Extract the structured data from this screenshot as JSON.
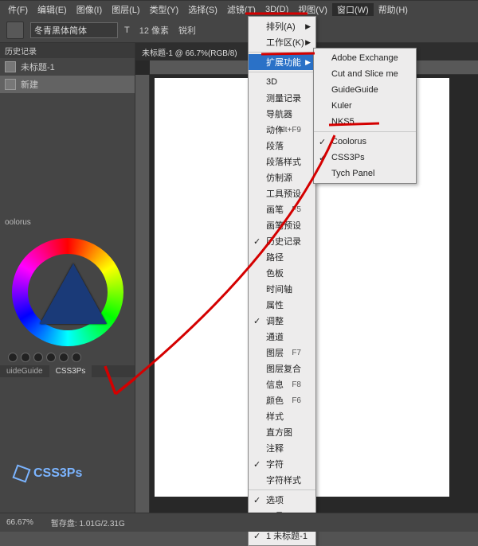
{
  "menubar": {
    "items": [
      "件(F)",
      "编辑(E)",
      "图像(I)",
      "图层(L)",
      "类型(Y)",
      "选择(S)",
      "滤镜(T)",
      "3D(D)",
      "视图(V)",
      "窗口(W)",
      "帮助(H)"
    ],
    "active_index": 9
  },
  "options": {
    "font_family": "冬青黑体简体",
    "size_icon": "T",
    "size_value": "12 像素",
    "aa": "锐利"
  },
  "doc_tab": "未标题-1 @ 66.7%(RGB/8)",
  "history": {
    "title": "历史记录",
    "doc": "未标题-1",
    "steps": [
      "新建"
    ]
  },
  "coolorus_title": "oolorus",
  "panel_tabs": {
    "guide": "uideGuide",
    "css3ps": "CSS3Ps"
  },
  "css3ps_logo": "CSS3Ps",
  "window_menu": [
    {
      "label": "排列(A)",
      "sub": true
    },
    {
      "label": "工作区(K)",
      "sub": true
    },
    {
      "sep": true
    },
    {
      "label": "扩展功能",
      "sub": true,
      "hover": true
    },
    {
      "sep": true
    },
    {
      "label": "3D"
    },
    {
      "label": "测量记录"
    },
    {
      "label": "导航器"
    },
    {
      "label": "动作",
      "shortcut": "Alt+F9"
    },
    {
      "label": "段落"
    },
    {
      "label": "段落样式"
    },
    {
      "label": "仿制源"
    },
    {
      "label": "工具预设"
    },
    {
      "label": "画笔",
      "shortcut": "F5"
    },
    {
      "label": "画笔预设"
    },
    {
      "label": "历史记录",
      "check": true
    },
    {
      "label": "路径"
    },
    {
      "label": "色板"
    },
    {
      "label": "时间轴"
    },
    {
      "label": "属性"
    },
    {
      "label": "调整",
      "check": true
    },
    {
      "label": "通道"
    },
    {
      "label": "图层",
      "shortcut": "F7"
    },
    {
      "label": "图层复合"
    },
    {
      "label": "信息",
      "shortcut": "F8"
    },
    {
      "label": "颜色",
      "shortcut": "F6"
    },
    {
      "label": "样式"
    },
    {
      "label": "直方图"
    },
    {
      "label": "注释"
    },
    {
      "label": "字符",
      "check": true
    },
    {
      "label": "字符样式"
    },
    {
      "sep": true
    },
    {
      "label": "选项",
      "check": true
    },
    {
      "label": "工具",
      "check": true
    },
    {
      "sep": true
    },
    {
      "label": "1 未标题-1",
      "check": true
    }
  ],
  "ext_submenu": [
    {
      "label": "Adobe Exchange"
    },
    {
      "label": "Cut and Slice me"
    },
    {
      "label": "GuideGuide"
    },
    {
      "label": "Kuler"
    },
    {
      "label": "NKS5"
    },
    {
      "sep": true
    },
    {
      "label": "Coolorus",
      "check": true
    },
    {
      "label": "CSS3Ps",
      "check": true
    },
    {
      "label": "Tych Panel"
    }
  ],
  "status": {
    "zoom": "66.67%",
    "disk_label": "暂存盘:",
    "disk": "1.01G/2.31G"
  }
}
